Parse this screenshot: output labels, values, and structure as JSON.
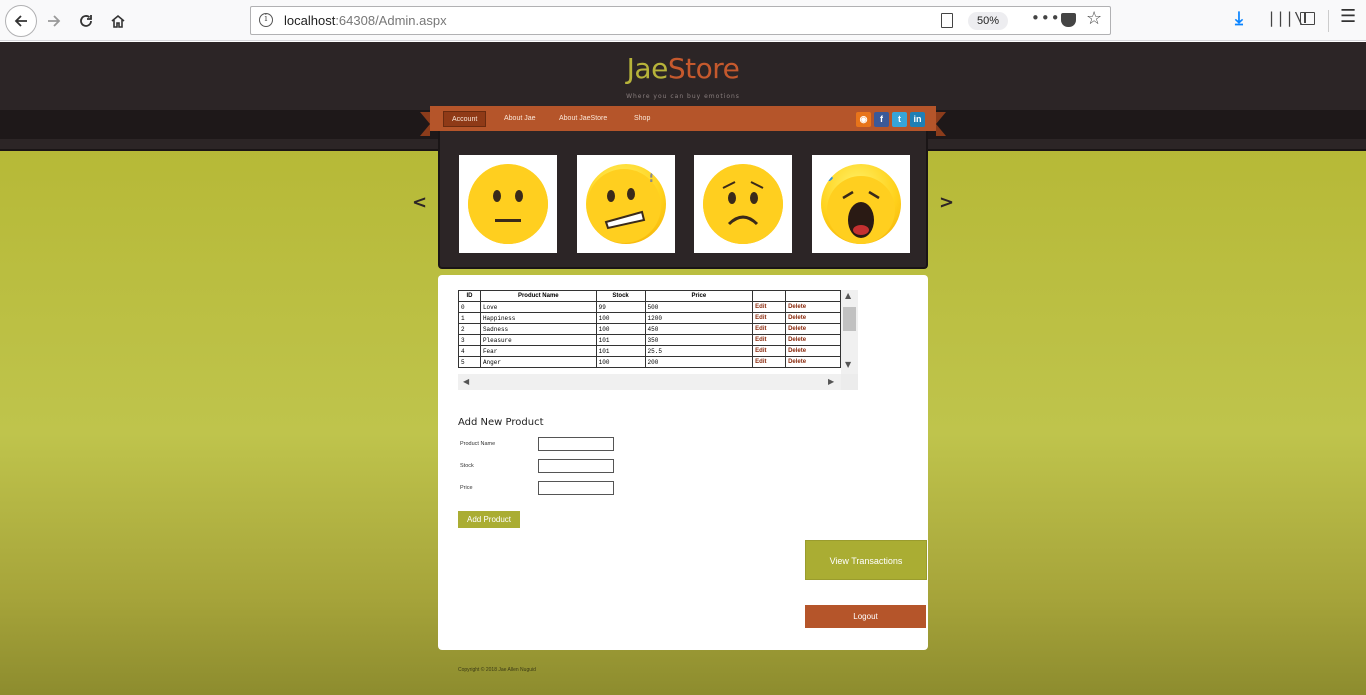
{
  "browser": {
    "url_host": "localhost",
    "url_path": ":64308/Admin.aspx",
    "zoom": "50%"
  },
  "site": {
    "logo_part1": "Jae",
    "logo_part2": "Store",
    "tagline": "Where you can buy emotions",
    "colors": {
      "accent_olive": "#b7b33a",
      "accent_rust": "#c5592d",
      "header_dark": "#2c2526"
    }
  },
  "nav": {
    "items": [
      "Account",
      "About Jae",
      "About JaeStore",
      "Shop"
    ],
    "social": [
      "rss-icon",
      "facebook-icon",
      "twitter-icon",
      "linkedin-icon"
    ]
  },
  "slider": {
    "slides": [
      "neutral-face",
      "confused-face",
      "sad-face",
      "screaming-face"
    ]
  },
  "grid": {
    "headers": [
      "ID",
      "Product Name",
      "Stock",
      "Price",
      "",
      ""
    ],
    "rows": [
      {
        "id": "0",
        "name": "Love",
        "stock": "99",
        "price": "500",
        "edit": "Edit",
        "delete": "Delete"
      },
      {
        "id": "1",
        "name": "Happiness",
        "stock": "100",
        "price": "1200",
        "edit": "Edit",
        "delete": "Delete"
      },
      {
        "id": "2",
        "name": "Sadness",
        "stock": "100",
        "price": "450",
        "edit": "Edit",
        "delete": "Delete"
      },
      {
        "id": "3",
        "name": "Pleasure",
        "stock": "101",
        "price": "350",
        "edit": "Edit",
        "delete": "Delete"
      },
      {
        "id": "4",
        "name": "Fear",
        "stock": "101",
        "price": "25.5",
        "edit": "Edit",
        "delete": "Delete"
      },
      {
        "id": "5",
        "name": "Anger",
        "stock": "100",
        "price": "200",
        "edit": "Edit",
        "delete": "Delete"
      }
    ]
  },
  "form": {
    "title": "Add New Product",
    "name_label": "Product Name",
    "stock_label": "Stock",
    "price_label": "Price",
    "name_value": "",
    "stock_value": "",
    "price_value": "",
    "submit_label": "Add Product"
  },
  "actions": {
    "view_transactions": "View Transactions",
    "logout": "Logout"
  },
  "footer": "Copyright © 2018 Jae Allen Nuguid"
}
